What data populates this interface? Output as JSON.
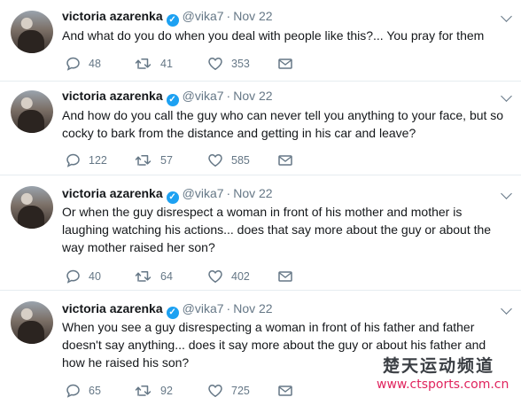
{
  "user": {
    "name": "victoria azarenka",
    "handle": "@vika7",
    "separator": "·",
    "verified_mark": "✓"
  },
  "tweets": [
    {
      "date": "Nov 22",
      "text": "And what do you do when you deal with people like this?... You pray for them",
      "replies": "48",
      "retweets": "41",
      "likes": "353"
    },
    {
      "date": "Nov 22",
      "text": "And how do you call the guy who can never tell you anything to your face, but so cocky to bark from the distance and getting in his car and leave?",
      "replies": "122",
      "retweets": "57",
      "likes": "585"
    },
    {
      "date": "Nov 22",
      "text": "Or when the guy disrespect a woman in front of his mother and mother is laughing watching his actions... does that say more about the guy or about the way mother raised her son?",
      "replies": "40",
      "retweets": "64",
      "likes": "402"
    },
    {
      "date": "Nov 22",
      "text": "When you see a guy disrespecting a woman in front of his father and father doesn't say anything... does it say more about the guy or about his father and how he raised his son?",
      "replies": "65",
      "retweets": "92",
      "likes": "725"
    }
  ],
  "icons": {
    "reply": "reply-icon",
    "retweet": "retweet-icon",
    "like": "heart-icon",
    "message": "envelope-icon",
    "more": "chevron-down-icon"
  },
  "colors": {
    "verified": "#1da1f2",
    "secondary_text": "#657786",
    "watermark_url": "#e0245e"
  },
  "watermark": {
    "title": "楚天运动频道",
    "url": "www.ctsports.com.cn"
  }
}
